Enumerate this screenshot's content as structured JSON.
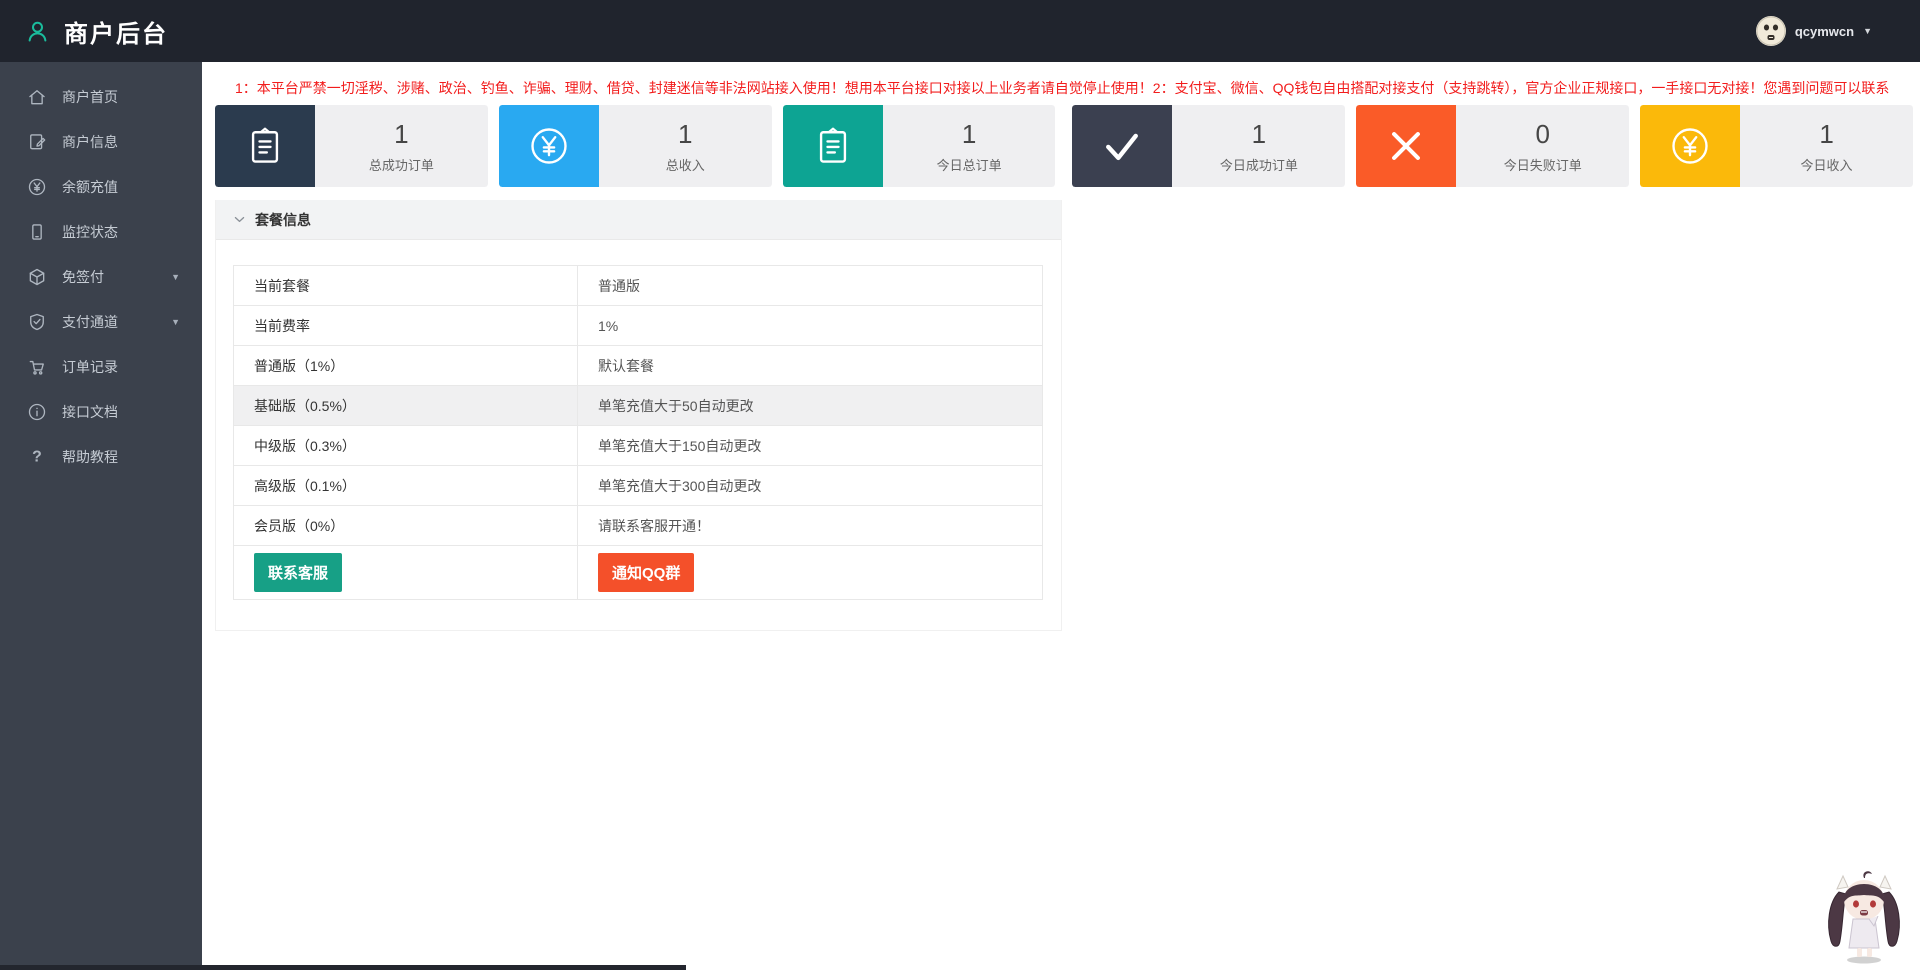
{
  "colors": {
    "header_bg": "#20242d",
    "sidebar_bg": "#3b414c",
    "accent_red": "#f21d1d",
    "table_red": "#f54545",
    "logo_green": "#1abc9c"
  },
  "header": {
    "title": "商户后台",
    "logo_icon": "person-icon",
    "user": {
      "name": "qcymwcn",
      "avatar_icon": "face-avatar-icon",
      "caret": "▼"
    }
  },
  "sidebar": {
    "items": [
      {
        "label": "商户首页",
        "icon": "home-icon",
        "has_submenu": false
      },
      {
        "label": "商户信息",
        "icon": "edit-document-icon",
        "has_submenu": false
      },
      {
        "label": "余额充值",
        "icon": "yen-circle-icon",
        "has_submenu": false
      },
      {
        "label": "监控状态",
        "icon": "monitor-icon",
        "has_submenu": false
      },
      {
        "label": "免签付",
        "icon": "cube-icon",
        "has_submenu": true
      },
      {
        "label": "支付通道",
        "icon": "shield-check-icon",
        "has_submenu": true
      },
      {
        "label": "订单记录",
        "icon": "cart-icon",
        "has_submenu": false
      },
      {
        "label": "接口文档",
        "icon": "info-circle-icon",
        "has_submenu": false
      },
      {
        "label": "帮助教程",
        "icon": "question-icon",
        "has_submenu": false
      }
    ],
    "submenu_caret": "▼"
  },
  "notice": {
    "text": "1：本平台严禁一切淫秽、涉赌、政治、钓鱼、诈骗、理财、借贷、封建迷信等非法网站接入使用！想用本平台接口对接以上业务者请自觉停止使用！2：支付宝、微信、QQ钱包自由搭配对接支付（支持跳转），官方企业正规接口，一手接口无对接！您遇到问题可以联系"
  },
  "stats": {
    "cards": [
      {
        "icon": "clipboard-icon",
        "icon_bg": "#2b3b4e",
        "value": "1",
        "label": "总成功订单"
      },
      {
        "icon": "yen-circle-icon",
        "icon_bg": "#29a9f1",
        "value": "1",
        "label": "总收入"
      },
      {
        "icon": "clipboard-icon",
        "icon_bg": "#0da493",
        "value": "1",
        "label": "今日总订单"
      },
      {
        "icon": "check-icon",
        "icon_bg": "#3b4050",
        "value": "1",
        "label": "今日成功订单"
      },
      {
        "icon": "close-icon",
        "icon_bg": "#fa5b28",
        "value": "0",
        "label": "今日失败订单"
      },
      {
        "icon": "yen-circle-icon",
        "icon_bg": "#fbb90a",
        "value": "1",
        "label": "今日收入"
      }
    ]
  },
  "package_panel": {
    "title": "套餐信息",
    "chevron_icon": "chevron-down-icon",
    "rows": [
      {
        "label": "当前套餐",
        "value": "普通版",
        "value_red": true,
        "highlighted": false
      },
      {
        "label": "当前费率",
        "value": "1%",
        "value_red": true,
        "highlighted": false
      },
      {
        "label": "普通版（1%）",
        "value": "默认套餐",
        "value_red": false,
        "highlighted": false
      },
      {
        "label": "基础版（0.5%）",
        "value": "单笔充值大于50自动更改",
        "value_red": false,
        "highlighted": true
      },
      {
        "label": "中级版（0.3%）",
        "value": "单笔充值大于150自动更改",
        "value_red": false,
        "highlighted": false
      },
      {
        "label": "高级版（0.1%）",
        "value": "单笔充值大于300自动更改",
        "value_red": false,
        "highlighted": false
      },
      {
        "label": "会员版（0%）",
        "value": "请联系客服开通！",
        "value_red": false,
        "highlighted": false
      }
    ],
    "buttons": [
      {
        "label": "联系客服",
        "color": "#17a086"
      },
      {
        "label": "通知QQ群",
        "color": "#f4502a"
      }
    ]
  },
  "mascot": {
    "name": "chibi-girl-mascot"
  }
}
